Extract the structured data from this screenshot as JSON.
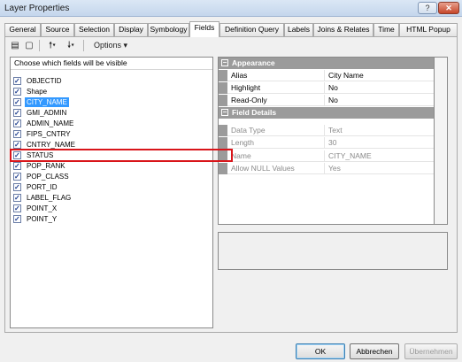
{
  "window": {
    "title": "Layer Properties",
    "help_label": "?",
    "close_label": "✕"
  },
  "tabs": [
    {
      "label": "General"
    },
    {
      "label": "Source"
    },
    {
      "label": "Selection"
    },
    {
      "label": "Display"
    },
    {
      "label": "Symbology"
    },
    {
      "label": "Fields"
    },
    {
      "label": "Definition Query"
    },
    {
      "label": "Labels"
    },
    {
      "label": "Joins & Relates"
    },
    {
      "label": "Time"
    },
    {
      "label": "HTML Popup"
    }
  ],
  "active_tab": "Fields",
  "toolbar": {
    "options_label": "Options ▾",
    "table_view_icon": "▤",
    "list_view_icon": "▢",
    "move_up_icon": "🠕▾",
    "move_down_icon": "🠗▾"
  },
  "field_list": {
    "header": "Choose which fields will be visible",
    "fields": [
      {
        "name": "OBJECTID",
        "checked": true,
        "selected": false
      },
      {
        "name": "Shape",
        "checked": true,
        "selected": false
      },
      {
        "name": "CITY_NAME",
        "checked": true,
        "selected": true
      },
      {
        "name": "GMI_ADMIN",
        "checked": true,
        "selected": false
      },
      {
        "name": "ADMIN_NAME",
        "checked": true,
        "selected": false
      },
      {
        "name": "FIPS_CNTRY",
        "checked": true,
        "selected": false
      },
      {
        "name": "CNTRY_NAME",
        "checked": true,
        "selected": false
      },
      {
        "name": "STATUS",
        "checked": true,
        "selected": false
      },
      {
        "name": "POP_RANK",
        "checked": true,
        "selected": false
      },
      {
        "name": "POP_CLASS",
        "checked": true,
        "selected": false
      },
      {
        "name": "PORT_ID",
        "checked": true,
        "selected": false
      },
      {
        "name": "LABEL_FLAG",
        "checked": true,
        "selected": false
      },
      {
        "name": "POINT_X",
        "checked": true,
        "selected": false
      },
      {
        "name": "POINT_Y",
        "checked": true,
        "selected": false
      }
    ]
  },
  "properties": {
    "appearance": {
      "label": "Appearance",
      "toggle": "−",
      "rows": [
        {
          "name": "Alias",
          "value": "City Name"
        },
        {
          "name": "Highlight",
          "value": "No"
        },
        {
          "name": "Read-Only",
          "value": "No"
        }
      ]
    },
    "field_details": {
      "label": "Field Details",
      "toggle": "−",
      "rows": [
        {
          "name": "Data Type",
          "value": "Text"
        },
        {
          "name": "Length",
          "value": "30"
        },
        {
          "name": "Name",
          "value": "CITY_NAME"
        },
        {
          "name": "Allow NULL Values",
          "value": "Yes"
        }
      ]
    }
  },
  "buttons": {
    "ok": "OK",
    "cancel": "Abbrechen",
    "apply": "Übernehmen"
  },
  "colors": {
    "selection": "#3399ff",
    "highlight_box": "#d9151a",
    "category_bar": "#9b9b9b"
  }
}
